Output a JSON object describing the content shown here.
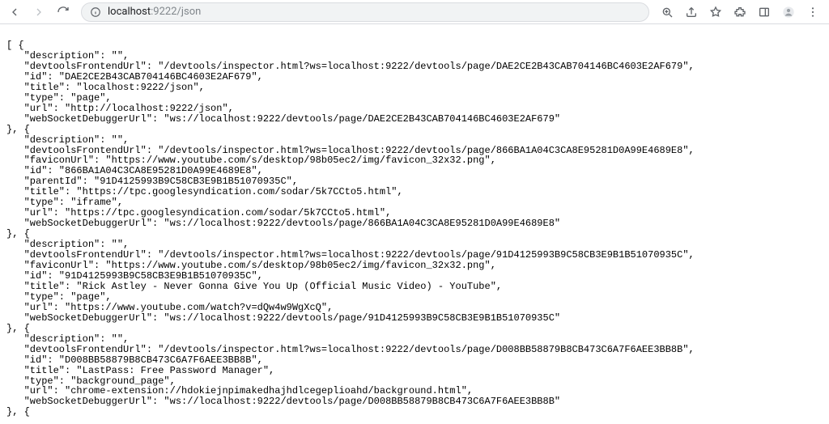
{
  "toolbar": {
    "address_host": "localhost",
    "address_rest": ":9222/json"
  },
  "json": [
    {
      "description": "",
      "devtoolsFrontendUrl": "/devtools/inspector.html?ws=localhost:9222/devtools/page/DAE2CE2B43CAB704146BC4603E2AF679",
      "id": "DAE2CE2B43CAB704146BC4603E2AF679",
      "title": "localhost:9222/json",
      "type": "page",
      "url": "http://localhost:9222/json",
      "webSocketDebuggerUrl": "ws://localhost:9222/devtools/page/DAE2CE2B43CAB704146BC4603E2AF679"
    },
    {
      "description": "",
      "devtoolsFrontendUrl": "/devtools/inspector.html?ws=localhost:9222/devtools/page/866BA1A04C3CA8E95281D0A99E4689E8",
      "faviconUrl": "https://www.youtube.com/s/desktop/98b05ec2/img/favicon_32x32.png",
      "id": "866BA1A04C3CA8E95281D0A99E4689E8",
      "parentId": "91D4125993B9C58CB3E9B1B51070935C",
      "title": "https://tpc.googlesyndication.com/sodar/5k7CCto5.html",
      "type": "iframe",
      "url": "https://tpc.googlesyndication.com/sodar/5k7CCto5.html",
      "webSocketDebuggerUrl": "ws://localhost:9222/devtools/page/866BA1A04C3CA8E95281D0A99E4689E8"
    },
    {
      "description": "",
      "devtoolsFrontendUrl": "/devtools/inspector.html?ws=localhost:9222/devtools/page/91D4125993B9C58CB3E9B1B51070935C",
      "faviconUrl": "https://www.youtube.com/s/desktop/98b05ec2/img/favicon_32x32.png",
      "id": "91D4125993B9C58CB3E9B1B51070935C",
      "title": "Rick Astley - Never Gonna Give You Up (Official Music Video) - YouTube",
      "type": "page",
      "url": "https://www.youtube.com/watch?v=dQw4w9WgXcQ",
      "webSocketDebuggerUrl": "ws://localhost:9222/devtools/page/91D4125993B9C58CB3E9B1B51070935C"
    },
    {
      "description": "",
      "devtoolsFrontendUrl": "/devtools/inspector.html?ws=localhost:9222/devtools/page/D008BB58879B8CB473C6A7F6AEE3BB8B",
      "id": "D008BB58879B8CB473C6A7F6AEE3BB8B",
      "title": "LastPass: Free Password Manager",
      "type": "background_page",
      "url": "chrome-extension://hdokiejnpimakedhajhdlcegeplioahd/background.html",
      "webSocketDebuggerUrl": "ws://localhost:9222/devtools/page/D008BB58879B8CB473C6A7F6AEE3BB8B"
    }
  ]
}
